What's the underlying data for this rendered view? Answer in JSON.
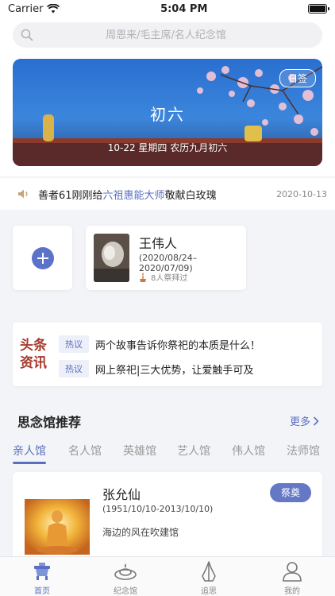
{
  "status_bar": {
    "carrier": "Carrier",
    "time": "5:04 PM"
  },
  "search": {
    "placeholder": "周恩来/毛主席/名人纪念馆"
  },
  "banner": {
    "badge": "日签",
    "title": "初六",
    "date_line": "10-22 星期四 农历九月初六"
  },
  "notice": {
    "prefix": "善者61刚刚给",
    "highlight": "六祖惠能大师",
    "suffix": "敬献白玫瑰",
    "time": "2020-10-13"
  },
  "my_memorial": {
    "name": "王伟人",
    "dates": "(2020/08/24–2020/07/09)",
    "worship_count": "8人祭拜过"
  },
  "headline": {
    "logo": "头条资讯",
    "items": [
      {
        "tag": "热议",
        "text": "两个故事告诉你祭祀的本质是什么！"
      },
      {
        "tag": "热议",
        "text": "网上祭祀|三大优势，让爱触手可及"
      }
    ]
  },
  "recommend": {
    "title": "思念馆推荐",
    "more": "更多",
    "tabs": [
      "亲人馆",
      "名人馆",
      "英雄馆",
      "艺人馆",
      "伟人馆",
      "法师馆"
    ],
    "active_tab": 0,
    "card": {
      "name": "张允仙",
      "dates": "(1951/10/10-2013/10/10)",
      "desc": "海边的风在吹建馆",
      "button": "祭奠"
    }
  },
  "tabbar": {
    "items": [
      {
        "label": "首页",
        "icon": "home-censer-icon",
        "active": true
      },
      {
        "label": "纪念馆",
        "icon": "memorial-hall-icon",
        "active": false
      },
      {
        "label": "追思",
        "icon": "praying-hands-icon",
        "active": false
      },
      {
        "label": "我的",
        "icon": "profile-icon",
        "active": false
      }
    ]
  },
  "colors": {
    "accent": "#5a6fc0",
    "button": "#6478c6",
    "headline_red": "#a63a2c"
  }
}
